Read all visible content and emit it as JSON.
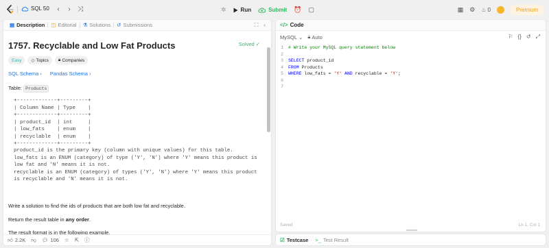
{
  "topbar": {
    "problem_list": "SQL 50",
    "run_label": "Run",
    "submit_label": "Submit",
    "streak_count": "0",
    "premium_label": "Premium"
  },
  "left": {
    "tabs": [
      {
        "label": "Description",
        "icon": "document-icon"
      },
      {
        "label": "Editorial",
        "icon": "book-icon"
      },
      {
        "label": "Solutions",
        "icon": "flask-icon"
      },
      {
        "label": "Submissions",
        "icon": "history-icon"
      }
    ],
    "title": "1757. Recyclable and Low Fat Products",
    "solved": "Solved",
    "tags": {
      "difficulty": "Easy",
      "topics": "Topics",
      "companies": "Companies"
    },
    "schemas": {
      "sql": "SQL Schema",
      "pandas": "Pandas Schema"
    },
    "table_label": "Table: ",
    "table_name": "Products",
    "schema_text": "+-------------+---------+\n| Column Name | Type    |\n+-------------+---------+\n| product_id  | int     |\n| low_fats    | enum    |\n| recyclable  | enum    |\n+-------------+---------+",
    "schema_desc": "product_id is the primary key (column with unique values) for this table.\nlow_fats is an ENUM (category) of type ('Y', 'N') where 'Y' means this product is\nlow fat and 'N' means it is not.\nrecyclable is an ENUM (category) of types ('Y', 'N') where 'Y' means this product\nis recyclable and 'N' means it is not.",
    "task": "Write a solution to find the ids of products that are both low fat and recyclable.",
    "return_prefix": "Return the result table in ",
    "return_bold": "any order",
    "return_suffix": ".",
    "format_text": "The result format is in the following example.",
    "footer": {
      "likes": "2.2K",
      "comments": "106"
    }
  },
  "editor": {
    "tab_label": "Code",
    "language": "MySQL",
    "mode": "Auto",
    "lines": [
      {
        "n": "1",
        "parts": [
          {
            "t": "# Write your MySQL query statement below",
            "c": "tok-cm"
          }
        ]
      },
      {
        "n": "2",
        "parts": []
      },
      {
        "n": "3",
        "parts": [
          {
            "t": "SELECT",
            "c": "tok-kw"
          },
          {
            "t": " product_id",
            "c": ""
          }
        ]
      },
      {
        "n": "4",
        "parts": [
          {
            "t": "FROM",
            "c": "tok-kw"
          },
          {
            "t": " Products",
            "c": ""
          }
        ]
      },
      {
        "n": "5",
        "parts": [
          {
            "t": "WHERE",
            "c": "tok-kw"
          },
          {
            "t": " low_fats = ",
            "c": ""
          },
          {
            "t": "'Y'",
            "c": "tok-str"
          },
          {
            "t": " ",
            "c": ""
          },
          {
            "t": "AND",
            "c": "tok-kw"
          },
          {
            "t": " recyclable = ",
            "c": ""
          },
          {
            "t": "'Y'",
            "c": "tok-str"
          },
          {
            "t": ";",
            "c": ""
          }
        ]
      },
      {
        "n": "6",
        "parts": []
      },
      {
        "n": "7",
        "parts": []
      }
    ],
    "status": "Saved",
    "position": "Ln 1, Col 1"
  },
  "bottom": {
    "testcase": "Testcase",
    "test_result": "Test Result"
  },
  "colors": {
    "accent_green": "#2cbb5d",
    "easy": "#1cb8b8",
    "link": "#1a73e8",
    "premium": "#f0a020"
  }
}
